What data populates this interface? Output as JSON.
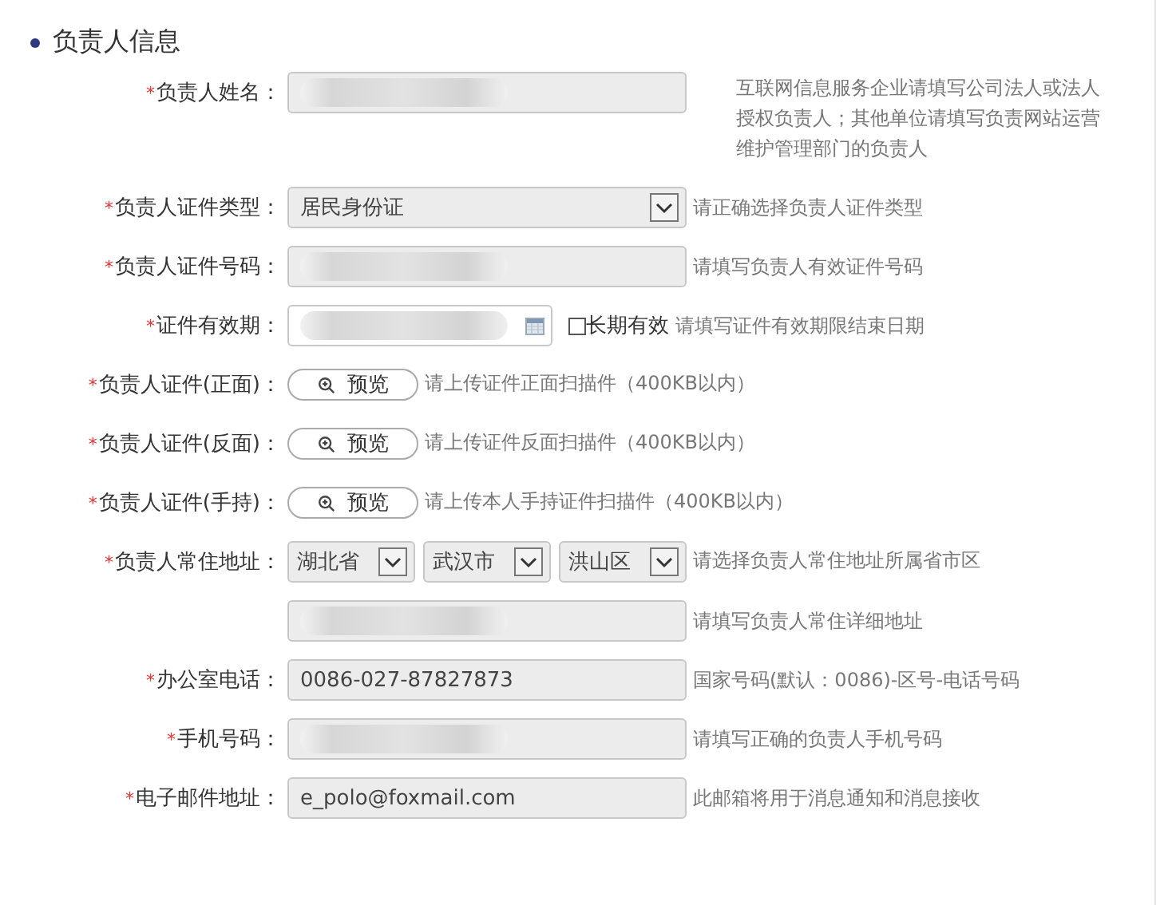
{
  "section_title": "负责人信息",
  "required_mark": "*",
  "rows": [
    {
      "kind": "text",
      "label": "负责人姓名：",
      "required": true,
      "redacted": true,
      "hint": "互联网信息服务企业请填写公司法人或法人授权负责人；其他单位请填写负责网站运营维护管理部门的负责人"
    },
    {
      "kind": "select",
      "label": "负责人证件类型：",
      "required": true,
      "value": "居民身份证",
      "hint": "请正确选择负责人证件类型"
    },
    {
      "kind": "text",
      "label": "负责人证件号码：",
      "required": true,
      "redacted": true,
      "hint": "请填写负责人有效证件号码"
    },
    {
      "kind": "date",
      "label": "证件有效期：",
      "required": true,
      "redacted": true,
      "checkbox": {
        "label": "长期有效",
        "checked": false
      },
      "hint": "请填写证件有效期限结束日期"
    },
    {
      "kind": "upload",
      "label": "负责人证件(正面)：",
      "required": true,
      "button": "预览",
      "hint": "请上传证件正面扫描件（400KB以内）"
    },
    {
      "kind": "upload",
      "label": "负责人证件(反面)：",
      "required": true,
      "button": "预览",
      "hint": "请上传证件反面扫描件（400KB以内）"
    },
    {
      "kind": "upload",
      "label": "负责人证件(手持)：",
      "required": true,
      "button": "预览",
      "hint": "请上传本人手持证件扫描件（400KB以内）"
    },
    {
      "kind": "region",
      "label": "负责人常住地址：",
      "required": true,
      "selects": [
        "湖北省",
        "武汉市",
        "洪山区"
      ],
      "hint": "请选择负责人常住地址所属省市区"
    },
    {
      "kind": "text",
      "redacted": true,
      "hint": "请填写负责人常住详细地址"
    },
    {
      "kind": "text",
      "label": "办公室电话：",
      "required": true,
      "redacted": false,
      "value": "0086-027-87827873",
      "hint": "国家号码(默认：0086)-区号-电话号码"
    },
    {
      "kind": "text",
      "label": "手机号码：",
      "required": true,
      "redacted": true,
      "hint": "请填写正确的负责人手机号码"
    },
    {
      "kind": "text",
      "label": "电子邮件地址：",
      "required": true,
      "redacted": false,
      "value": "e_polo@foxmail.com",
      "hint": "此邮箱将用于消息通知和消息接收"
    }
  ]
}
